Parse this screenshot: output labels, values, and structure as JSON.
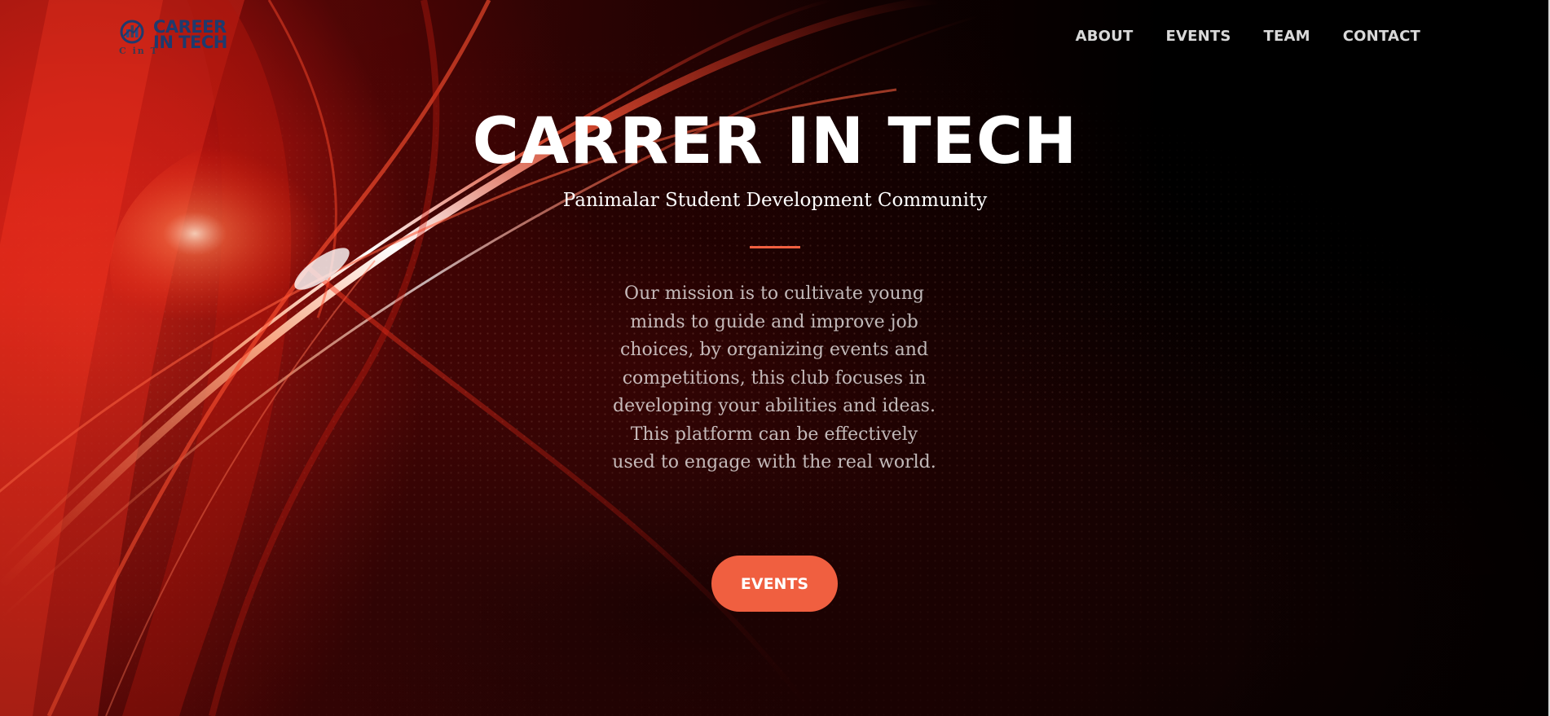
{
  "brand": {
    "name": "CAREER IN TECH",
    "monogram": "C in T",
    "logo_icon": "bar-chart-globe-icon",
    "color": "#1e3a6e"
  },
  "nav": {
    "items": [
      {
        "label": "ABOUT"
      },
      {
        "label": "EVENTS"
      },
      {
        "label": "TEAM"
      },
      {
        "label": "CONTACT"
      }
    ]
  },
  "hero": {
    "title": "CARRER IN TECH",
    "subtitle": "Panimalar Student Development Community",
    "mission": "Our mission is to cultivate young minds to guide and improve job choices, by organizing events and competitions, this club focuses in developing your abilities and ideas. This platform can be effectively used to engage with the real world.",
    "cta_label": "EVENTS",
    "background": "red-light-streak-dotted-tunnel-image"
  },
  "colors": {
    "accent": "#f05f40",
    "text": "#ffffff",
    "background": "#000000"
  }
}
